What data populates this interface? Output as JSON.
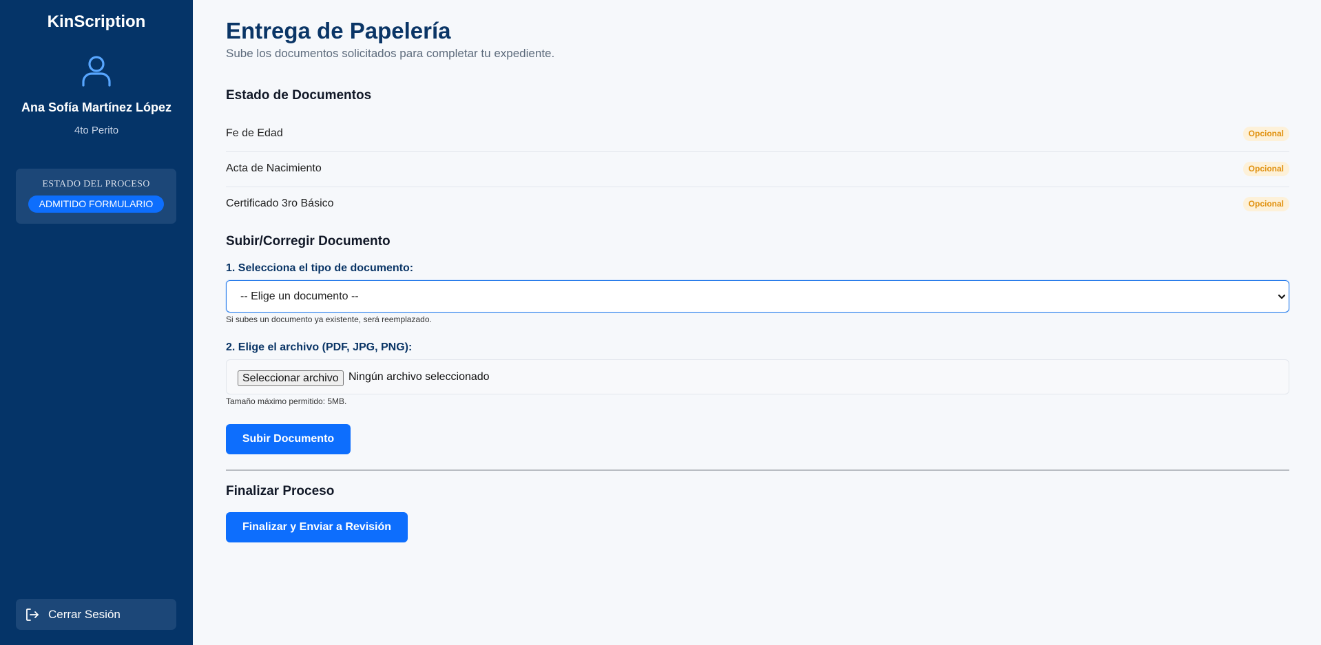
{
  "sidebar": {
    "brand": "KinScription",
    "user_name": "Ana Sofía Martínez López",
    "user_role": "4to Perito",
    "status_title": "ESTADO DEL PROCESO",
    "status_value": "ADMITIDO FORMULARIO",
    "logout_label": "Cerrar Sesión"
  },
  "header": {
    "title": "Entrega de Papelería",
    "subtitle": "Sube los documentos solicitados para completar tu expediente."
  },
  "documents": {
    "title": "Estado de Documentos",
    "items": [
      {
        "name": "Fe de Edad",
        "status": "Opcional"
      },
      {
        "name": "Acta de Nacimiento",
        "status": "Opcional"
      },
      {
        "name": "Certificado 3ro Básico",
        "status": "Opcional"
      }
    ]
  },
  "upload": {
    "title": "Subir/Corregir Documento",
    "type_label": "1. Selecciona el tipo de documento:",
    "type_selected": "-- Elige un documento --",
    "type_hint": "Si subes un documento ya existente, será reemplazado.",
    "file_label": "2. Elige el archivo (PDF, JPG, PNG):",
    "file_button": "Seleccionar archivo",
    "file_status": "Ningún archivo seleccionado",
    "file_hint": "Tamaño máximo permitido: 5MB.",
    "submit_label": "Subir Documento"
  },
  "finalize": {
    "title": "Finalizar Proceso",
    "button_label": "Finalizar y Enviar a Revisión"
  },
  "colors": {
    "sidebar_bg": "#053468",
    "accent": "#0d6efd",
    "badge_text": "#e0900d",
    "badge_bg": "#fdf1d9",
    "title": "#0a3566"
  },
  "icons": {
    "avatar": "user-icon",
    "logout": "logout-icon",
    "select": "chevron-down-icon"
  }
}
